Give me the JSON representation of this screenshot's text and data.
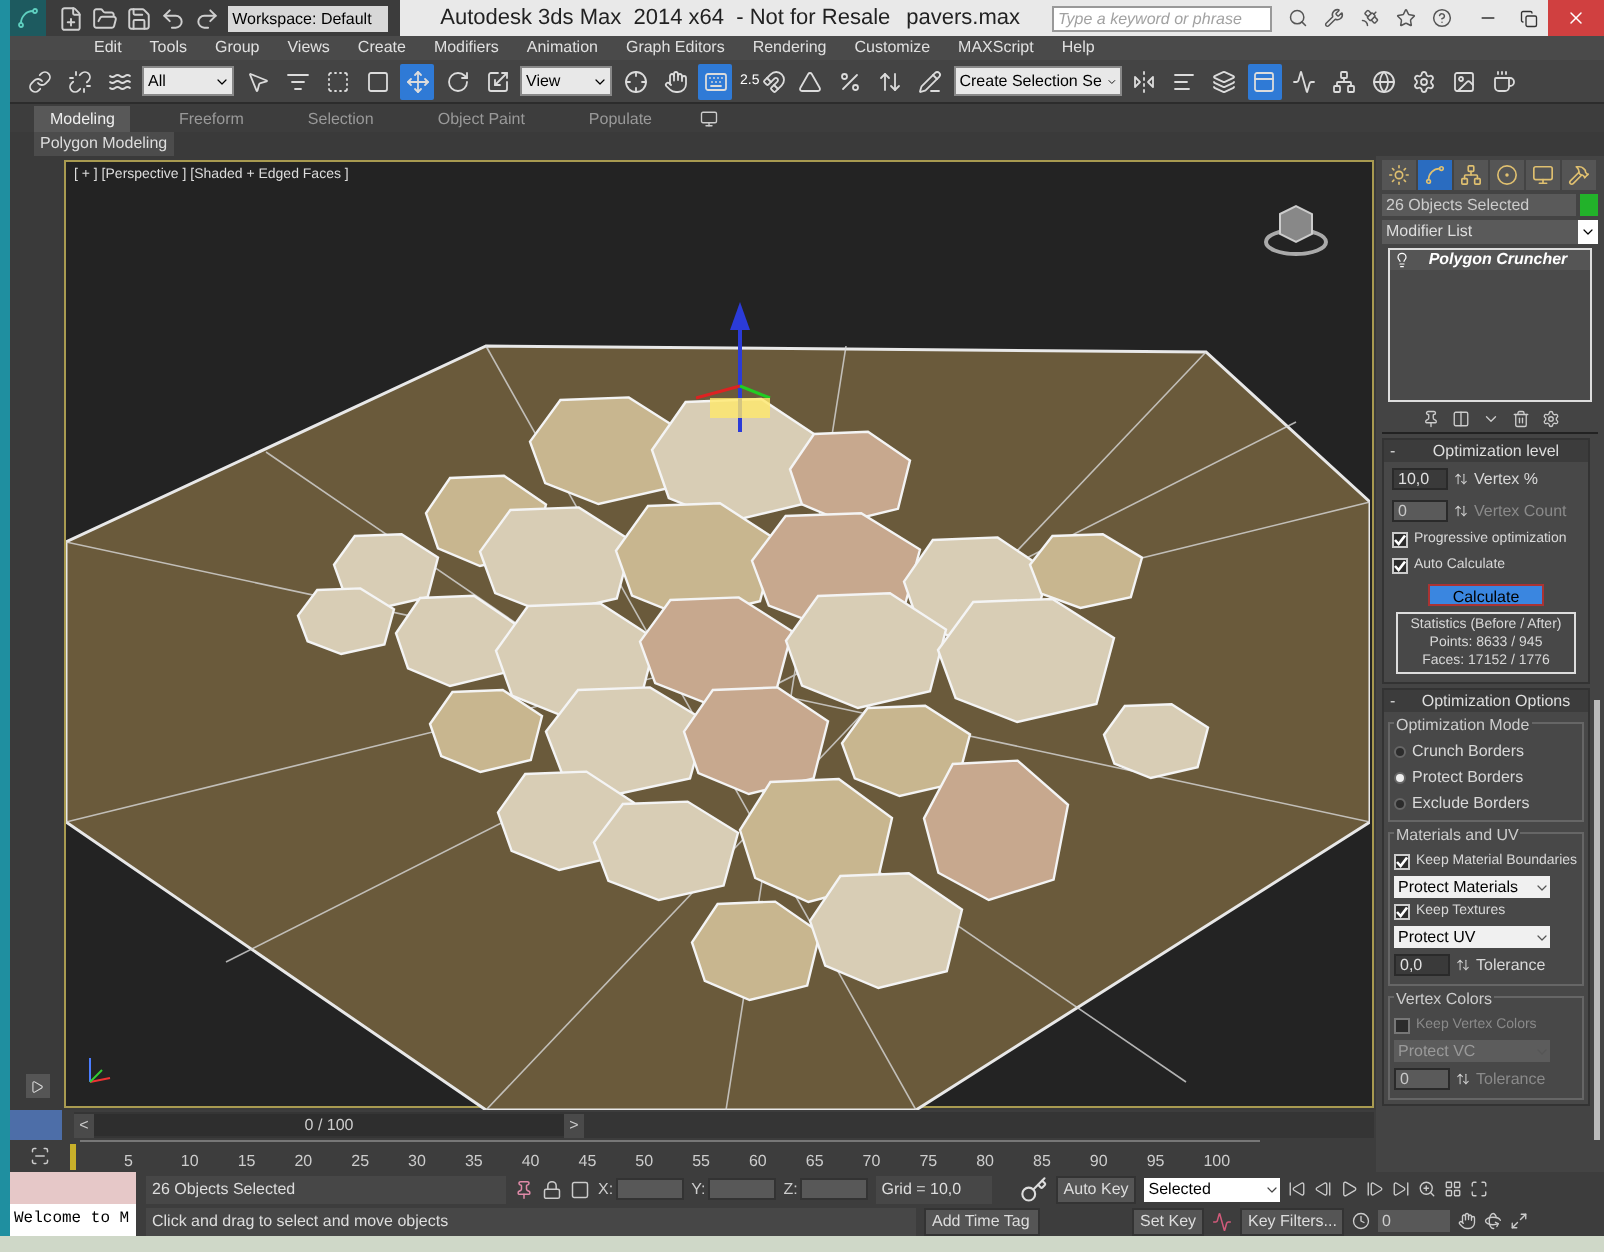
{
  "window": {
    "title": "Autodesk 3ds Max  2014 x64  - Not for Resale",
    "file": "pavers.max",
    "workspace": "Workspace: Default",
    "search_placeholder": "Type a keyword or phrase"
  },
  "menu": [
    "Edit",
    "Tools",
    "Group",
    "Views",
    "Create",
    "Modifiers",
    "Animation",
    "Graph Editors",
    "Rendering",
    "Customize",
    "MAXScript",
    "Help"
  ],
  "toolbar": [
    {
      "kind": "link",
      "selected": false
    },
    {
      "kind": "unlink",
      "selected": false
    },
    {
      "kind": "bind",
      "selected": false
    },
    {
      "kind": "dropdown",
      "value": "All"
    },
    {
      "kind": "select",
      "selected": false
    },
    {
      "kind": "select-by-name",
      "selected": false
    },
    {
      "kind": "region",
      "selected": false
    },
    {
      "kind": "crossing",
      "selected": false
    },
    {
      "kind": "move",
      "selected": true
    },
    {
      "kind": "rotate",
      "selected": false
    },
    {
      "kind": "scale",
      "selected": false
    },
    {
      "kind": "dropdown",
      "value": "View"
    },
    {
      "kind": "pivot",
      "selected": false
    },
    {
      "kind": "manipulate",
      "selected": false
    },
    {
      "kind": "keyboard",
      "selected": true
    },
    {
      "kind": "snap",
      "label": "2.5",
      "selected": false
    },
    {
      "kind": "angle-snap",
      "selected": false
    },
    {
      "kind": "percent-snap",
      "selected": false
    },
    {
      "kind": "spinner-snap",
      "selected": false
    },
    {
      "kind": "edit-sets",
      "selected": false
    },
    {
      "kind": "dropdown",
      "value": "Create Selection Se"
    },
    {
      "kind": "mirror",
      "selected": false
    },
    {
      "kind": "align",
      "selected": false
    },
    {
      "kind": "layers",
      "selected": false
    },
    {
      "kind": "ribbon",
      "selected": true
    },
    {
      "kind": "curve-editor",
      "selected": false
    },
    {
      "kind": "schematic",
      "selected": false
    },
    {
      "kind": "material",
      "selected": false
    },
    {
      "kind": "render-setup",
      "selected": false
    },
    {
      "kind": "frame-window",
      "selected": false
    },
    {
      "kind": "render",
      "selected": false
    }
  ],
  "ribbon": {
    "tabs": [
      {
        "label": "Modeling",
        "selected": true
      },
      {
        "label": "Freeform",
        "selected": false
      },
      {
        "label": "Selection",
        "selected": false
      },
      {
        "label": "Object Paint",
        "selected": false
      },
      {
        "label": "Populate",
        "selected": false
      }
    ],
    "panel": "Polygon Modeling"
  },
  "viewport": {
    "label": "[ + ] [Perspective ] [Shaded + Edged Faces ]"
  },
  "command_panel": {
    "tabs": [
      {
        "kind": "create",
        "selected": false
      },
      {
        "kind": "modify",
        "selected": true
      },
      {
        "kind": "hierarchy",
        "selected": false
      },
      {
        "kind": "motion",
        "selected": false
      },
      {
        "kind": "display",
        "selected": false
      },
      {
        "kind": "utilities",
        "selected": false
      }
    ],
    "object_name": "26 Objects Selected",
    "modifier_list": "Modifier List",
    "stack": [
      "Polygon Cruncher"
    ],
    "rollouts": [
      {
        "sign": "-",
        "title": "Optimization level",
        "groups": [
          {
            "items": [
              {
                "kind": "spinner",
                "value": "10,0",
                "caption": "Vertex %",
                "disabled": false
              },
              {
                "kind": "spinner",
                "value": "0",
                "caption": "Vertex Count",
                "disabled": true
              },
              {
                "kind": "check",
                "label": "Progressive optimization",
                "checked": true,
                "disabled": false
              },
              {
                "kind": "check",
                "label": "Auto Calculate",
                "checked": true,
                "disabled": false
              },
              {
                "kind": "button",
                "label": "Calculate",
                "disabled": false
              },
              {
                "kind": "stats",
                "lines": [
                  "Statistics (Before / After)",
                  "Points: 8633 / 945",
                  "Faces: 17152 / 1776"
                ],
                "disabled": false
              }
            ]
          }
        ]
      },
      {
        "sign": "-",
        "title": "Optimization Options",
        "groups": [
          {
            "title": "Optimization Mode",
            "items": [
              {
                "kind": "radio",
                "label": "Crunch Borders",
                "selected": false,
                "disabled": false
              },
              {
                "kind": "radio",
                "label": "Protect Borders",
                "selected": true,
                "disabled": false
              },
              {
                "kind": "radio",
                "label": "Exclude Borders",
                "selected": false,
                "disabled": false
              }
            ]
          },
          {
            "title": "Materials and UV",
            "items": [
              {
                "kind": "check",
                "label": "Keep Material Boundaries",
                "checked": true,
                "disabled": false
              },
              {
                "kind": "dropdown",
                "value": "Protect Materials",
                "disabled": false
              },
              {
                "kind": "check",
                "label": "Keep Textures",
                "checked": true,
                "disabled": false
              },
              {
                "kind": "dropdown",
                "value": "Protect UV",
                "disabled": false
              },
              {
                "kind": "spinner",
                "value": "0,0",
                "caption": "Tolerance",
                "disabled": false
              }
            ]
          },
          {
            "title": "Vertex Colors",
            "items": [
              {
                "kind": "check",
                "label": "Keep Vertex Colors",
                "checked": false,
                "disabled": true
              },
              {
                "kind": "dropdown",
                "value": "Protect VC",
                "disabled": true
              },
              {
                "kind": "spinner",
                "value": "0",
                "caption": "Tolerance",
                "disabled": true
              }
            ]
          }
        ]
      }
    ]
  },
  "timeline": {
    "level": 0,
    "frame": "0 / 100",
    "prev": "<",
    "next": ">",
    "ticks": [
      "5",
      "10",
      "15",
      "20",
      "25",
      "30",
      "35",
      "40",
      "45",
      "50",
      "55",
      "60",
      "65",
      "70",
      "75",
      "80",
      "85",
      "90",
      "95",
      "100"
    ]
  },
  "status": {
    "listener": "Welcome to M",
    "selection": "26 Objects Selected",
    "prompt": "Click and drag to select and move objects",
    "coords": [
      "X:",
      "Y:",
      "Z:"
    ],
    "grid": "Grid = 10,0",
    "time_tag": "Add Time Tag",
    "auto_key": "Auto Key",
    "set_key": "Set Key",
    "key_set": "Selected",
    "key_filters": "Key Filters...",
    "current_frame": "0"
  }
}
